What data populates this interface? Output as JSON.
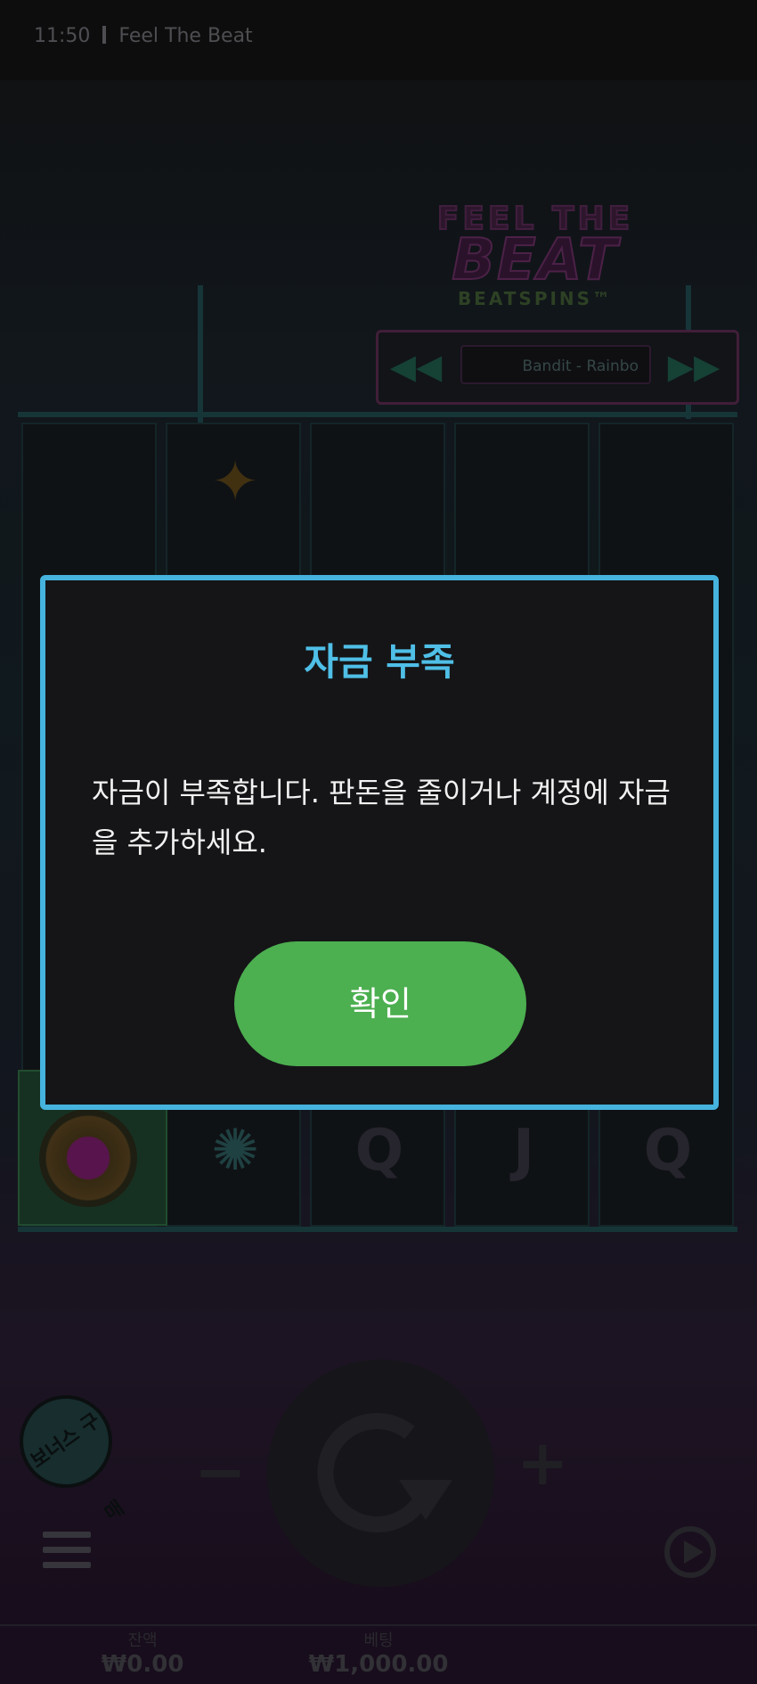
{
  "status": {
    "time": "11:50",
    "game_name": "Feel The Beat"
  },
  "logo": {
    "line1": "FEEL THE",
    "line2": "BEAT",
    "line3": "BEATSPINS™"
  },
  "music": {
    "prev_icon": "rewind-icon",
    "next_icon": "fast-forward-icon",
    "track": "Bandit - Rainbo"
  },
  "controls": {
    "bonus_buy": "보너스 구매",
    "minus": "−",
    "plus": "+",
    "spin_icon": "spin-arrow-icon",
    "menu_icon": "hamburger-menu-icon",
    "autoplay_icon": "autoplay-icon"
  },
  "footer": {
    "balance_label": "잔액",
    "balance_value": "₩0.00",
    "bet_label": "베팅",
    "bet_value": "₩1,000.00"
  },
  "dialog": {
    "title": "자금 부족",
    "message": "자금이 부족합니다. 판돈을 줄이거나 계정에 자금을 추가하세요.",
    "ok_label": "확인"
  },
  "colors": {
    "dialog_border": "#45b3dd",
    "dialog_title": "#4fbfe7",
    "ok_button": "#4caf50"
  }
}
